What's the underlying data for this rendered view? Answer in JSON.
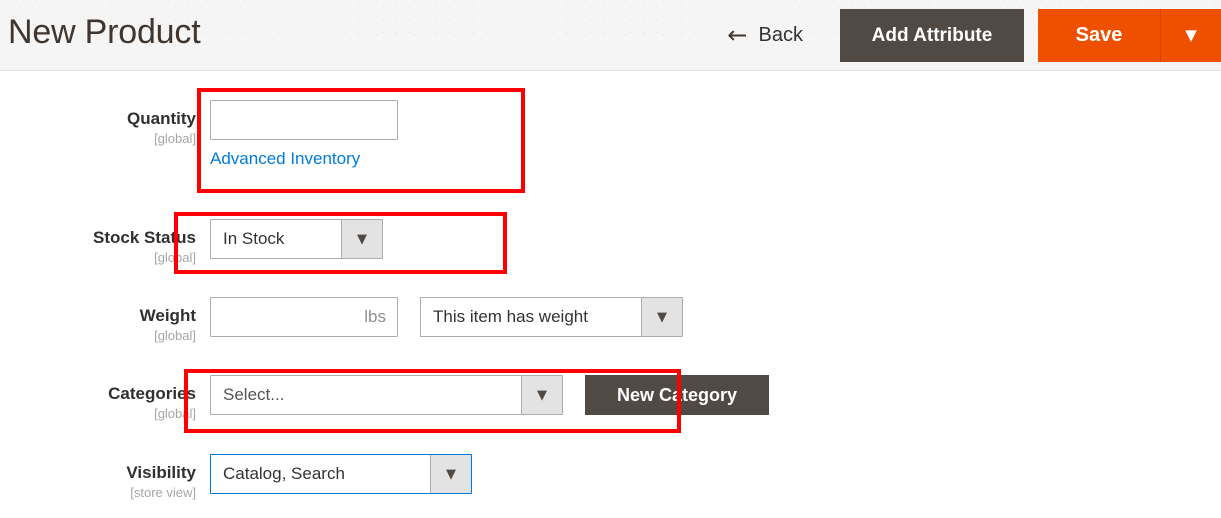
{
  "header": {
    "title": "New Product",
    "back": {
      "label": "Back",
      "icon": "arrow-left-icon",
      "glyph": "←"
    },
    "add_attribute": {
      "label": "Add Attribute"
    },
    "save": {
      "label": "Save",
      "caret_glyph": "▼",
      "caret_icon": "chevron-down-icon"
    }
  },
  "form": {
    "quantity": {
      "label": "Quantity",
      "scope": "[global]",
      "value": "",
      "placeholder": "",
      "link": "Advanced Inventory"
    },
    "stock_status": {
      "label": "Stock Status",
      "scope": "[global]",
      "value": "In Stock",
      "caret_glyph": "▼"
    },
    "weight": {
      "label": "Weight",
      "scope": "[global]",
      "value": "",
      "placeholder": "",
      "unit": "lbs",
      "type_value": "This item has weight",
      "caret_glyph": "▼"
    },
    "categories": {
      "label": "Categories",
      "scope": "[global]",
      "value": "Select...",
      "caret_glyph": "▼",
      "new_category_label": "New Category"
    },
    "visibility": {
      "label": "Visibility",
      "scope": "[store view]",
      "value": "Catalog, Search",
      "caret_glyph": "▼"
    }
  },
  "annotations": {
    "highlight_color": "#ff0000",
    "boxes": [
      "quantity-field",
      "stock-status-field",
      "categories-field"
    ]
  },
  "colors": {
    "accent_orange": "#ef5000",
    "dark_button": "#514943",
    "link_blue": "#007bdb",
    "header_background": "#f5f5f5"
  }
}
